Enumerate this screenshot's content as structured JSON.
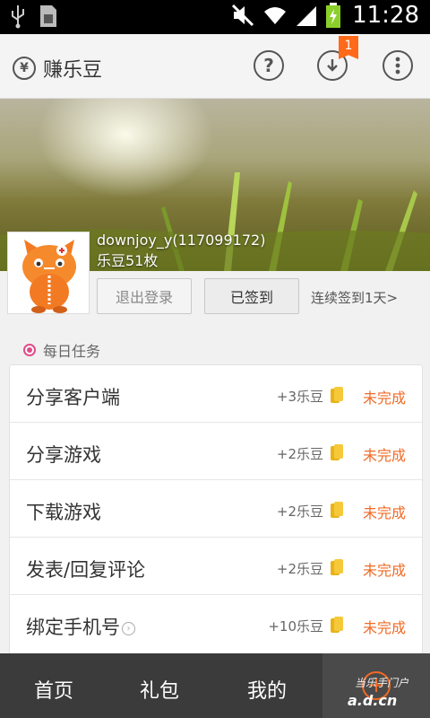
{
  "status_bar": {
    "time": "11:28",
    "icons": [
      "usb-icon",
      "sim-icon",
      "mute-icon",
      "wifi-icon",
      "signal-icon",
      "battery-charging-icon"
    ]
  },
  "app_bar": {
    "title": "赚乐豆",
    "currency_symbol": "¥",
    "help_glyph": "?",
    "download_badge": "1",
    "accent": "#ff6a1a"
  },
  "profile": {
    "username": "downjoy_y(117099172)",
    "points": "乐豆51枚",
    "logout_label": "退出登录",
    "signed_label": "已签到",
    "streak_text": "连续签到1天>"
  },
  "daily_tasks": {
    "title": "每日任务",
    "items": [
      {
        "name": "分享客户端",
        "reward": "+3乐豆",
        "status": "未完成"
      },
      {
        "name": "分享游戏",
        "reward": "+2乐豆",
        "status": "未完成"
      },
      {
        "name": "下载游戏",
        "reward": "+2乐豆",
        "status": "未完成"
      },
      {
        "name": "发表/回复评论",
        "reward": "+2乐豆",
        "status": "未完成"
      },
      {
        "name": "绑定手机号",
        "reward": "+10乐豆",
        "status": "未完成"
      }
    ]
  },
  "bottom_nav": {
    "items": [
      "首页",
      "礼包",
      "我的"
    ],
    "fab_glyph": "+"
  },
  "watermark": {
    "line1": "当乐手门户",
    "line2": "a.d.cn"
  }
}
